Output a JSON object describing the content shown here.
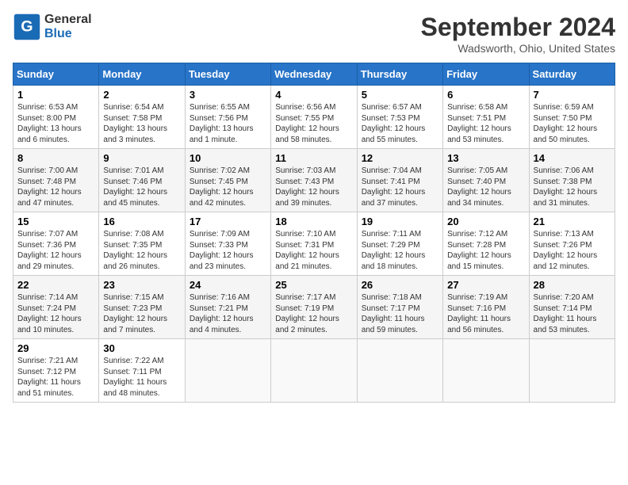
{
  "logo": {
    "line1": "General",
    "line2": "Blue"
  },
  "title": "September 2024",
  "location": "Wadsworth, Ohio, United States",
  "days_of_week": [
    "Sunday",
    "Monday",
    "Tuesday",
    "Wednesday",
    "Thursday",
    "Friday",
    "Saturday"
  ],
  "weeks": [
    [
      {
        "day": "1",
        "info": "Sunrise: 6:53 AM\nSunset: 8:00 PM\nDaylight: 13 hours\nand 6 minutes."
      },
      {
        "day": "2",
        "info": "Sunrise: 6:54 AM\nSunset: 7:58 PM\nDaylight: 13 hours\nand 3 minutes."
      },
      {
        "day": "3",
        "info": "Sunrise: 6:55 AM\nSunset: 7:56 PM\nDaylight: 13 hours\nand 1 minute."
      },
      {
        "day": "4",
        "info": "Sunrise: 6:56 AM\nSunset: 7:55 PM\nDaylight: 12 hours\nand 58 minutes."
      },
      {
        "day": "5",
        "info": "Sunrise: 6:57 AM\nSunset: 7:53 PM\nDaylight: 12 hours\nand 55 minutes."
      },
      {
        "day": "6",
        "info": "Sunrise: 6:58 AM\nSunset: 7:51 PM\nDaylight: 12 hours\nand 53 minutes."
      },
      {
        "day": "7",
        "info": "Sunrise: 6:59 AM\nSunset: 7:50 PM\nDaylight: 12 hours\nand 50 minutes."
      }
    ],
    [
      {
        "day": "8",
        "info": "Sunrise: 7:00 AM\nSunset: 7:48 PM\nDaylight: 12 hours\nand 47 minutes."
      },
      {
        "day": "9",
        "info": "Sunrise: 7:01 AM\nSunset: 7:46 PM\nDaylight: 12 hours\nand 45 minutes."
      },
      {
        "day": "10",
        "info": "Sunrise: 7:02 AM\nSunset: 7:45 PM\nDaylight: 12 hours\nand 42 minutes."
      },
      {
        "day": "11",
        "info": "Sunrise: 7:03 AM\nSunset: 7:43 PM\nDaylight: 12 hours\nand 39 minutes."
      },
      {
        "day": "12",
        "info": "Sunrise: 7:04 AM\nSunset: 7:41 PM\nDaylight: 12 hours\nand 37 minutes."
      },
      {
        "day": "13",
        "info": "Sunrise: 7:05 AM\nSunset: 7:40 PM\nDaylight: 12 hours\nand 34 minutes."
      },
      {
        "day": "14",
        "info": "Sunrise: 7:06 AM\nSunset: 7:38 PM\nDaylight: 12 hours\nand 31 minutes."
      }
    ],
    [
      {
        "day": "15",
        "info": "Sunrise: 7:07 AM\nSunset: 7:36 PM\nDaylight: 12 hours\nand 29 minutes."
      },
      {
        "day": "16",
        "info": "Sunrise: 7:08 AM\nSunset: 7:35 PM\nDaylight: 12 hours\nand 26 minutes."
      },
      {
        "day": "17",
        "info": "Sunrise: 7:09 AM\nSunset: 7:33 PM\nDaylight: 12 hours\nand 23 minutes."
      },
      {
        "day": "18",
        "info": "Sunrise: 7:10 AM\nSunset: 7:31 PM\nDaylight: 12 hours\nand 21 minutes."
      },
      {
        "day": "19",
        "info": "Sunrise: 7:11 AM\nSunset: 7:29 PM\nDaylight: 12 hours\nand 18 minutes."
      },
      {
        "day": "20",
        "info": "Sunrise: 7:12 AM\nSunset: 7:28 PM\nDaylight: 12 hours\nand 15 minutes."
      },
      {
        "day": "21",
        "info": "Sunrise: 7:13 AM\nSunset: 7:26 PM\nDaylight: 12 hours\nand 12 minutes."
      }
    ],
    [
      {
        "day": "22",
        "info": "Sunrise: 7:14 AM\nSunset: 7:24 PM\nDaylight: 12 hours\nand 10 minutes."
      },
      {
        "day": "23",
        "info": "Sunrise: 7:15 AM\nSunset: 7:23 PM\nDaylight: 12 hours\nand 7 minutes."
      },
      {
        "day": "24",
        "info": "Sunrise: 7:16 AM\nSunset: 7:21 PM\nDaylight: 12 hours\nand 4 minutes."
      },
      {
        "day": "25",
        "info": "Sunrise: 7:17 AM\nSunset: 7:19 PM\nDaylight: 12 hours\nand 2 minutes."
      },
      {
        "day": "26",
        "info": "Sunrise: 7:18 AM\nSunset: 7:17 PM\nDaylight: 11 hours\nand 59 minutes."
      },
      {
        "day": "27",
        "info": "Sunrise: 7:19 AM\nSunset: 7:16 PM\nDaylight: 11 hours\nand 56 minutes."
      },
      {
        "day": "28",
        "info": "Sunrise: 7:20 AM\nSunset: 7:14 PM\nDaylight: 11 hours\nand 53 minutes."
      }
    ],
    [
      {
        "day": "29",
        "info": "Sunrise: 7:21 AM\nSunset: 7:12 PM\nDaylight: 11 hours\nand 51 minutes."
      },
      {
        "day": "30",
        "info": "Sunrise: 7:22 AM\nSunset: 7:11 PM\nDaylight: 11 hours\nand 48 minutes."
      },
      {
        "day": "",
        "info": ""
      },
      {
        "day": "",
        "info": ""
      },
      {
        "day": "",
        "info": ""
      },
      {
        "day": "",
        "info": ""
      },
      {
        "day": "",
        "info": ""
      }
    ]
  ]
}
